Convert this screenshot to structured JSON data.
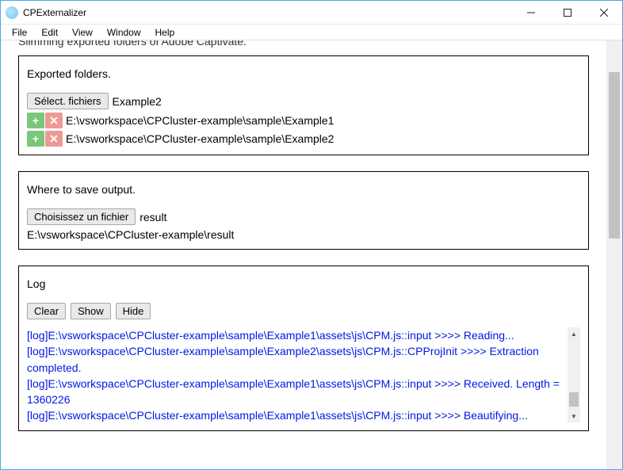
{
  "window": {
    "title": "CPExternalizer"
  },
  "menu": {
    "file": "File",
    "edit": "Edit",
    "view": "View",
    "window": "Window",
    "help": "Help"
  },
  "header_cut": "Slimming exported folders of Adobe Captivate.",
  "exported": {
    "label": "Exported folders.",
    "select_btn": "Sélect. fichiers",
    "selected_name": "Example2",
    "files": [
      {
        "path": "E:\\vsworkspace\\CPCluster-example\\sample\\Example1"
      },
      {
        "path": "E:\\vsworkspace\\CPCluster-example\\sample\\Example2"
      }
    ]
  },
  "output": {
    "label": "Where to save output.",
    "choose_btn": "Choisissez un fichier",
    "chosen_name": "result",
    "path": "E:\\vsworkspace\\CPCluster-example\\result"
  },
  "log": {
    "label": "Log",
    "clear_btn": "Clear",
    "show_btn": "Show",
    "hide_btn": "Hide",
    "lines": [
      "[log]E:\\vsworkspace\\CPCluster-example\\sample\\Example1\\assets\\js\\CPM.js::input >>>> Reading...",
      "[log]E:\\vsworkspace\\CPCluster-example\\sample\\Example2\\assets\\js\\CPM.js::CPProjInit >>>> Extraction completed.",
      "[log]E:\\vsworkspace\\CPCluster-example\\sample\\Example1\\assets\\js\\CPM.js::input >>>> Received. Length = 1360226",
      "[log]E:\\vsworkspace\\CPCluster-example\\sample\\Example1\\assets\\js\\CPM.js::input >>>> Beautifying..."
    ]
  }
}
